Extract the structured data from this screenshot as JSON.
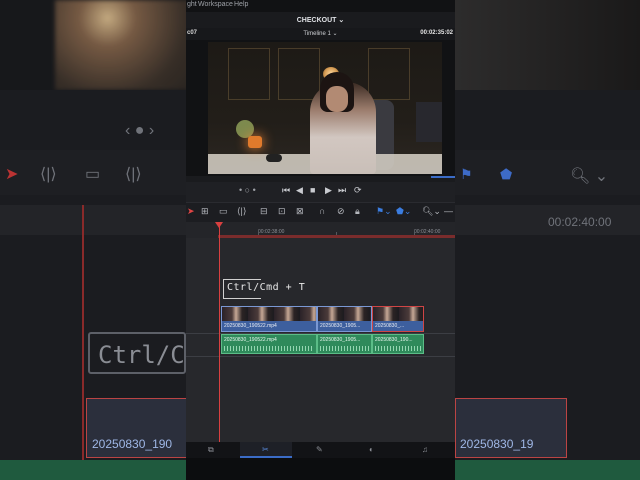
{
  "menu": {
    "item1": "ght",
    "item2": "Workspace",
    "item3": "Help"
  },
  "project_title": "CHECKOUT",
  "project_chevron": "⌄",
  "viewer": {
    "left_timecode": "c07",
    "timeline_name": "Timeline 1",
    "timeline_chevron": "⌄",
    "right_timecode": "00:02:35:02"
  },
  "transport": {
    "dots": "• ○ •",
    "skip_back": "⏮",
    "play_reverse": "◀",
    "stop": "■",
    "play": "▶",
    "skip_forward": "⏭",
    "loop": "⟳"
  },
  "ruler": {
    "tc1": "00:02:38:00",
    "tc2": "00:02:40:00"
  },
  "shortcut": "Ctrl/Cmd + T",
  "video_clips": [
    {
      "name": "20250830_190522.mp4"
    },
    {
      "name": "20250830_1905..."
    },
    {
      "name": "20250830_..."
    }
  ],
  "audio_clips": [
    {
      "name": "20250830_190522.mp4"
    },
    {
      "name": "20250830_1905..."
    },
    {
      "name": "20250830_190..."
    }
  ],
  "background": {
    "shortcut": "Ctrl/C",
    "clip_name_left": "20250830_190",
    "clip_name_right": "20250830_19",
    "timecode": "00:02:40:00"
  },
  "colors": {
    "accent_blue": "#3b6cc7",
    "playhead_red": "#d84040",
    "video_clip": "#3d5f9e",
    "audio_clip": "#2f8a5b"
  },
  "page_tabs": [
    "media-icon",
    "cut-icon",
    "edit-icon",
    "fusion-icon",
    "color-icon",
    "fairlight-icon"
  ]
}
